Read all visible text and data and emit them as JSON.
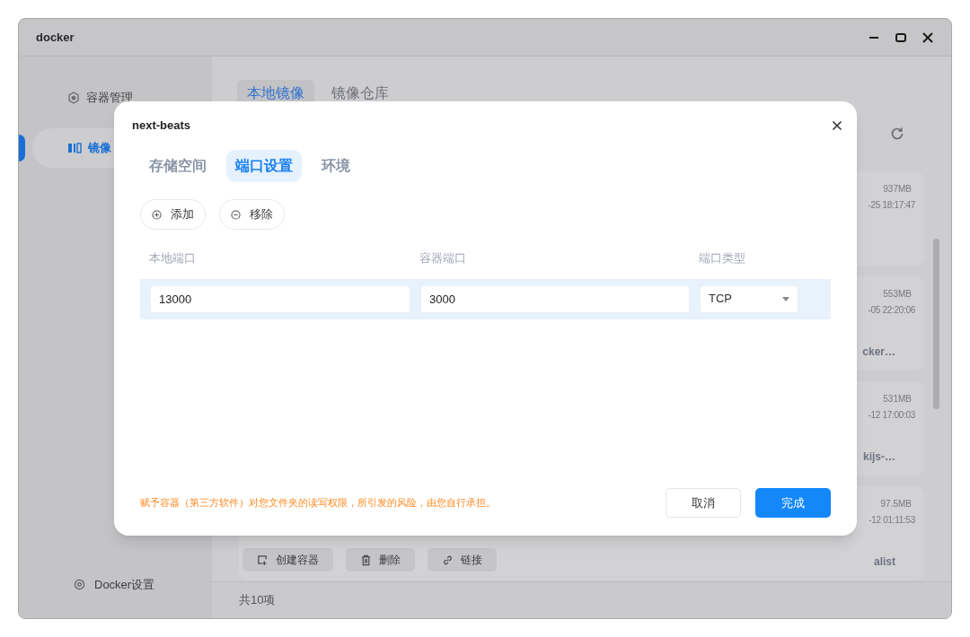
{
  "window": {
    "title": "docker"
  },
  "sidebar": {
    "items": [
      {
        "label": "容器管理",
        "selected": false
      },
      {
        "label": "镜像",
        "selected": true
      }
    ],
    "footer_item": "Docker设置"
  },
  "main": {
    "tabs": [
      {
        "label": "本地镜像",
        "selected": true
      },
      {
        "label": "镜像仓库",
        "selected": false
      }
    ],
    "images": [
      {
        "size": "937MB",
        "date": "-25 18:17:47"
      },
      {
        "size": "553MB",
        "date": "-05 22:20:06",
        "name": "cker…"
      },
      {
        "size": "531MB",
        "date": "-12 17:00:03",
        "name": "kijs-…"
      },
      {
        "size": "97.5MB",
        "date": "-12 01:11:53",
        "name": "alist",
        "actions": [
          "创建容器",
          "删除",
          "链接"
        ]
      }
    ],
    "count": "共10项"
  },
  "dialog": {
    "title": "next-beats",
    "tabs": [
      {
        "label": "存储空间",
        "selected": false
      },
      {
        "label": "端口设置",
        "selected": true
      },
      {
        "label": "环境",
        "selected": false
      }
    ],
    "actions": [
      {
        "label": "添加",
        "kind": "add"
      },
      {
        "label": "移除",
        "kind": "remove"
      }
    ],
    "columns": [
      "本地端口",
      "容器端口",
      "端口类型"
    ],
    "rows": [
      {
        "local_port": "13000",
        "container_port": "3000",
        "port_type": "TCP",
        "selected": true
      }
    ],
    "warning": "赋予容器（第三方软件）对您文件夹的读写权限，所引发的风险，由您自行承担。",
    "buttons": [
      {
        "label": "取消",
        "kind": "secondary"
      },
      {
        "label": "完成",
        "kind": "primary"
      }
    ]
  }
}
